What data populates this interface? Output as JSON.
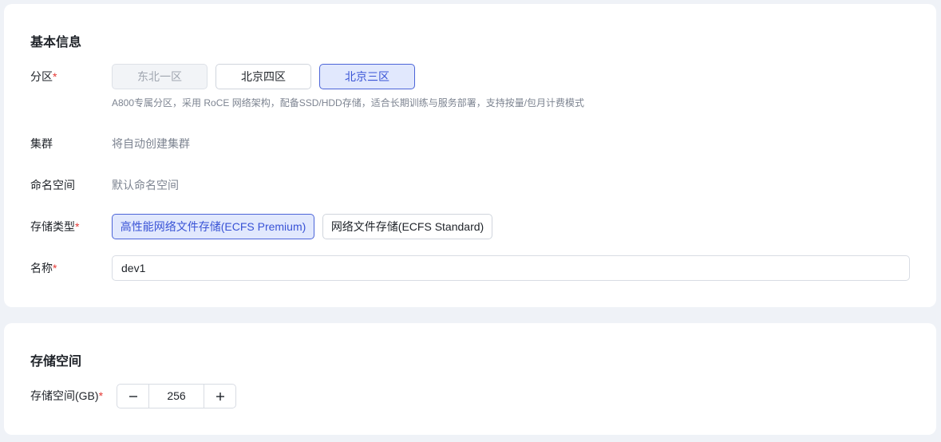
{
  "basic": {
    "title": "基本信息",
    "zone": {
      "label": "分区",
      "required_mark": "*",
      "options": [
        "东北一区",
        "北京四区",
        "北京三区"
      ],
      "selected": "北京三区",
      "disabled": [
        "东北一区"
      ],
      "hint": "A800专属分区，采用 RoCE 网络架构，配备SSD/HDD存储，适合长期训练与服务部署，支持按量/包月计费模式"
    },
    "cluster": {
      "label": "集群",
      "value": "将自动创建集群"
    },
    "namespace": {
      "label": "命名空间",
      "value": "默认命名空间"
    },
    "storage_type": {
      "label": "存储类型",
      "required_mark": "*",
      "options": [
        "高性能网络文件存储(ECFS Premium)",
        "网络文件存储(ECFS Standard)"
      ],
      "selected": "高性能网络文件存储(ECFS Premium)"
    },
    "name": {
      "label": "名称",
      "required_mark": "*",
      "value": "dev1"
    }
  },
  "storage": {
    "title": "存储空间",
    "size": {
      "label": "存储空间(GB)",
      "required_mark": "*",
      "value": "256",
      "minus_icon": "minus-icon",
      "plus_icon": "plus-icon"
    }
  },
  "colors": {
    "page_bg": "#eff2f7",
    "card_bg": "#ffffff",
    "accent": "#3953d6",
    "accent_bg": "#e1e8fd",
    "required": "#e53935"
  }
}
